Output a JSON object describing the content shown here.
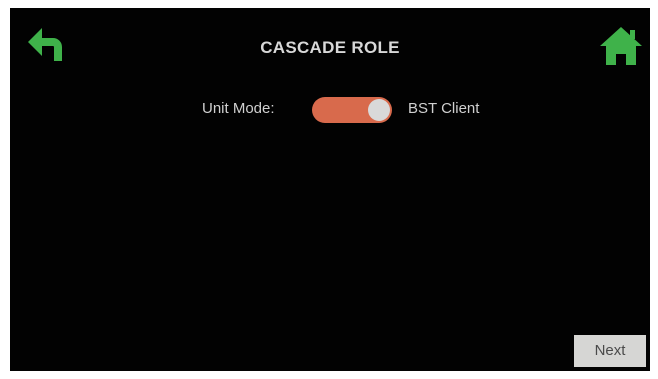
{
  "header": {
    "title": "CASCADE ROLE",
    "back_icon": "back-arrow-icon",
    "home_icon": "home-icon"
  },
  "settings": {
    "unit_mode_label": "Unit Mode:",
    "unit_mode_value": "BST Client",
    "toggle_state": "on"
  },
  "footer": {
    "next_label": "Next"
  },
  "colors": {
    "background": "#020202",
    "icon_green": "#3fb24a",
    "toggle_on": "#d86a4c",
    "text": "#d0d0d0",
    "button_bg": "#d6d6d4"
  }
}
